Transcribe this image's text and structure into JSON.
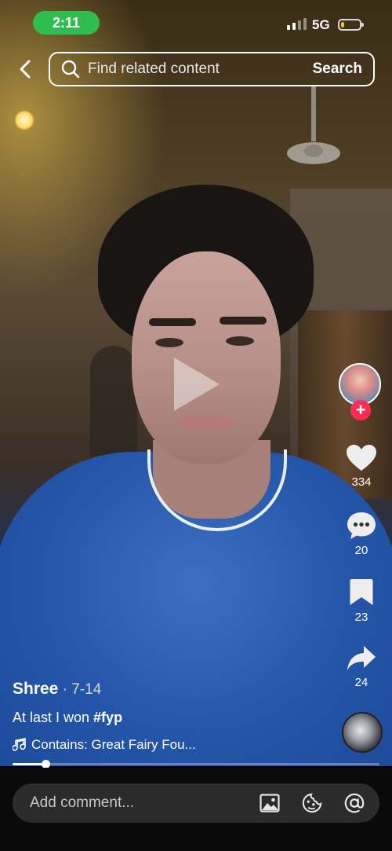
{
  "status": {
    "time": "2:11",
    "network": "5G",
    "battery_level": 0.2
  },
  "search": {
    "placeholder": "Find related content",
    "button_label": "Search"
  },
  "actions": {
    "likes": "334",
    "comments": "20",
    "saves": "23",
    "shares": "24"
  },
  "post": {
    "author": "Shree",
    "date": " · 7-14",
    "caption_text": "At last I won ",
    "caption_tag": "#fyp",
    "sound": "Contains: Great Fairy Fou..."
  },
  "playback": {
    "progress": 0.09
  },
  "comment_bar": {
    "placeholder": "Add comment..."
  },
  "colors": {
    "accent": "#fe2c55",
    "status_pill": "#2fbd4f",
    "battery": "#f4c21b"
  }
}
